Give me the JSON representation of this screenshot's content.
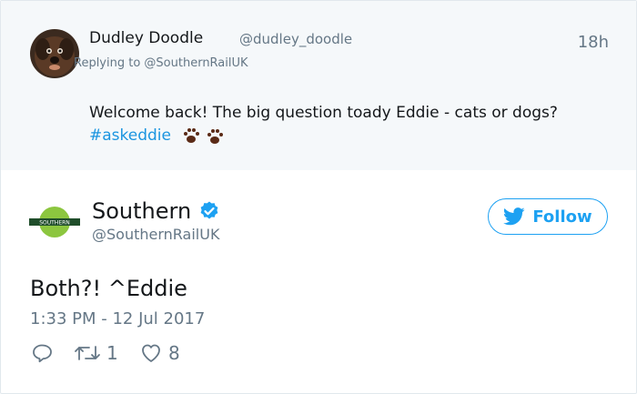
{
  "reply_tweet": {
    "author_name": "Dudley Doodle",
    "author_handle": "@dudley_doodle",
    "time_ago": "18h",
    "replying_to": "Replying to @SouthernRailUK",
    "text": "Welcome back! The big question toady Eddie - cats or dogs?",
    "hashtag": "#askeddie",
    "emoji": "paw-prints"
  },
  "main_tweet": {
    "author_name": "Southern",
    "author_handle": "@SouthernRailUK",
    "verified": true,
    "logo_text": "SOUTHERN",
    "follow_label": "Follow",
    "text": "Both?! ^Eddie",
    "timestamp": "1:33 PM - 12 Jul 2017",
    "actions": {
      "reply_icon": "reply-icon",
      "retweet_count": "1",
      "like_count": "8"
    }
  },
  "colors": {
    "accent": "#1da1f2",
    "hashtag": "#1b95e0",
    "muted": "#657786",
    "text": "#14171a",
    "reply_bg": "#f5f8fa",
    "brand_green": "#8cc63f"
  }
}
